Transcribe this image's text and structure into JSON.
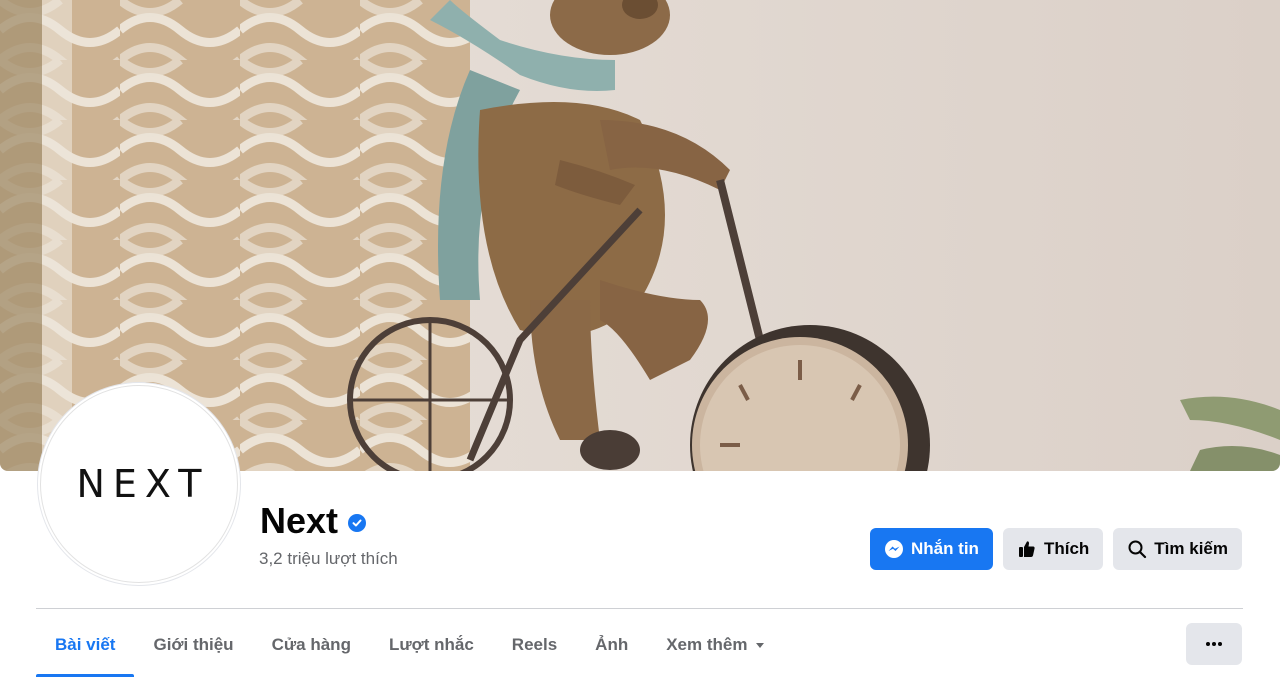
{
  "page": {
    "logo_text": "NEXT",
    "name": "Next",
    "likes": "3,2 triệu lượt thích"
  },
  "actions": {
    "message": "Nhắn tin",
    "like": "Thích",
    "search": "Tìm kiếm"
  },
  "tabs": [
    {
      "label": "Bài viết",
      "active": true
    },
    {
      "label": "Giới thiệu",
      "active": false
    },
    {
      "label": "Cửa hàng",
      "active": false
    },
    {
      "label": "Lượt nhắc",
      "active": false
    },
    {
      "label": "Reels",
      "active": false
    },
    {
      "label": "Ảnh",
      "active": false
    },
    {
      "label": "Xem thêm",
      "active": false
    }
  ],
  "colors": {
    "accent": "#1877f2",
    "secondary_button": "#e4e6eb",
    "muted_text": "#65676b"
  },
  "icons": {
    "verified": "verified-badge-icon",
    "message": "messenger-icon",
    "like": "thumbs-up-icon",
    "search": "search-icon",
    "dropdown": "caret-down-icon",
    "more": "more-horizontal-icon"
  }
}
